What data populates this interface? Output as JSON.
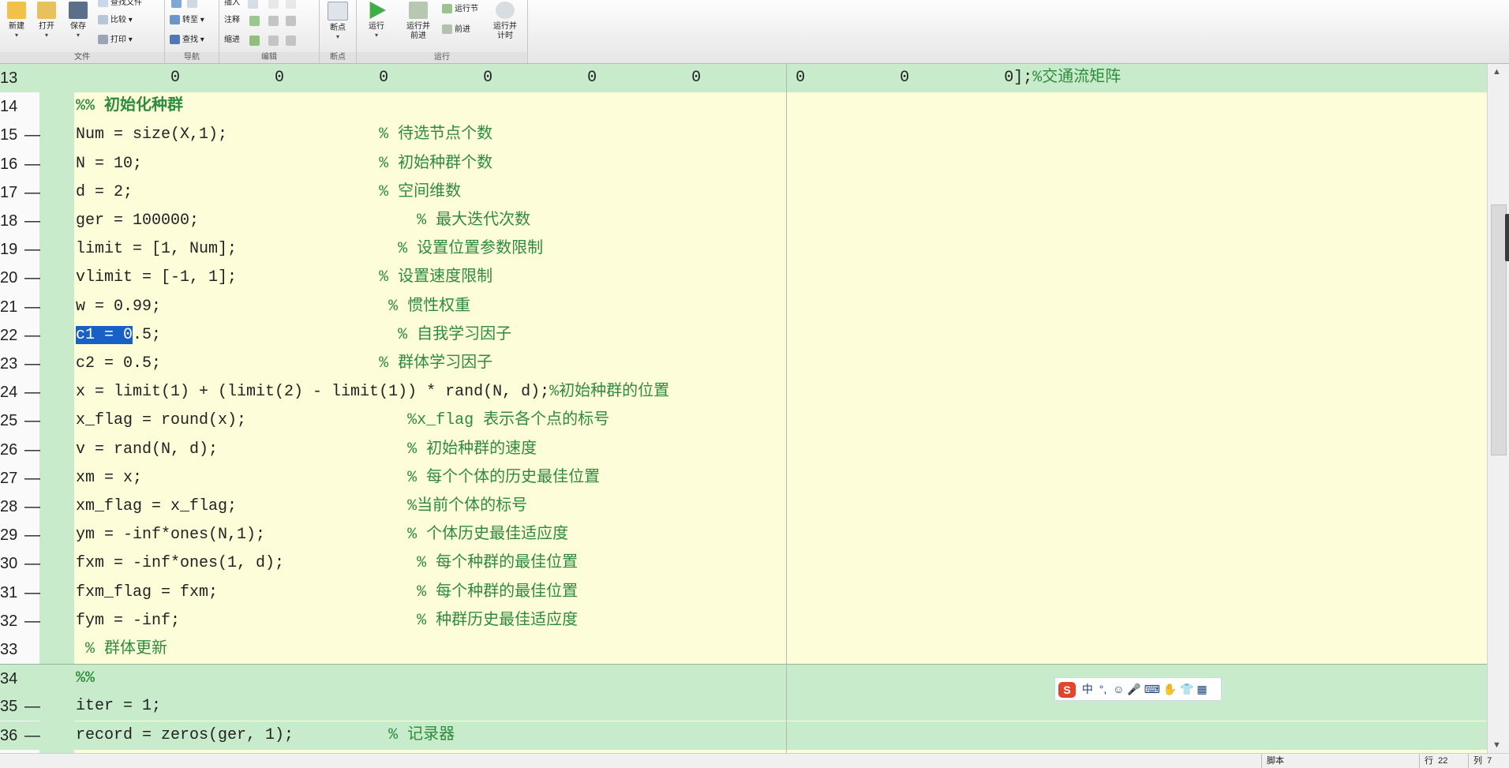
{
  "toolstrip": {
    "groups": {
      "file": "文件",
      "navigate": "导航",
      "edit": "编辑",
      "breakpoints": "断点",
      "run": "运行"
    },
    "buttons": {
      "new": "新建",
      "open": "打开",
      "save": "保存",
      "find_files": "查找文件",
      "compare": "比较",
      "print": "打印",
      "goto": "转至",
      "find": "查找",
      "insert": "插入",
      "comment": "注释",
      "indent": "缩进",
      "breakpoints": "断点",
      "run": "运行",
      "run_advance_1": "运行并",
      "run_advance_2": "前进",
      "run_section": "运行节",
      "advance": "前进",
      "run_time_1": "运行并",
      "run_time_2": "计时"
    },
    "icons": [
      "new-icon",
      "open-icon",
      "save-icon",
      "compare-icon",
      "print-icon",
      "back-icon",
      "goto-icon",
      "find-icon",
      "insert-icon",
      "fx-icon",
      "comment-icon",
      "indent-icon",
      "breakpoint-icon",
      "run-icon",
      "run-advance-icon",
      "run-section-icon",
      "advance-icon",
      "run-time-icon"
    ]
  },
  "editor": {
    "selected_text": "c1 = 0",
    "lines": [
      {
        "num": "13",
        "dash": false,
        "cell": true,
        "code": "          0          0          0          0          0          0          0          0          0];",
        "comment": "%交通流矩阵"
      },
      {
        "num": "14",
        "dash": false,
        "cell": false,
        "header": "%% 初始化种群"
      },
      {
        "num": "15",
        "dash": true,
        "cell": false,
        "code": "Num = size(X,1);                ",
        "comment": "% 待选节点个数"
      },
      {
        "num": "16",
        "dash": true,
        "cell": false,
        "code": "N = 10;                         ",
        "comment": "% 初始种群个数"
      },
      {
        "num": "17",
        "dash": true,
        "cell": false,
        "code": "d = 2;                          ",
        "comment": "% 空间维数"
      },
      {
        "num": "18",
        "dash": true,
        "cell": false,
        "code": "ger = 100000;                       ",
        "comment": "% 最大迭代次数"
      },
      {
        "num": "19",
        "dash": true,
        "cell": false,
        "code": "limit = [1, Num];                 ",
        "comment": "% 设置位置参数限制"
      },
      {
        "num": "20",
        "dash": true,
        "cell": false,
        "code": "vlimit = [-1, 1];               ",
        "comment": "% 设置速度限制"
      },
      {
        "num": "21",
        "dash": true,
        "cell": false,
        "code": "w = 0.99;                        ",
        "comment": "% 惯性权重"
      },
      {
        "num": "22",
        "dash": true,
        "cell": false,
        "selected": true,
        "code_after": ".5;                         ",
        "comment": "% 自我学习因子"
      },
      {
        "num": "23",
        "dash": true,
        "cell": false,
        "code": "c2 = 0.5;                       ",
        "comment": "% 群体学习因子"
      },
      {
        "num": "24",
        "dash": true,
        "cell": false,
        "code": "x = limit(1) + (limit(2) - limit(1)) * rand(N, d);",
        "comment": "%初始种群的位置"
      },
      {
        "num": "25",
        "dash": true,
        "cell": false,
        "code": "x_flag = round(x);                 ",
        "comment": "%x_flag 表示各个点的标号"
      },
      {
        "num": "26",
        "dash": true,
        "cell": false,
        "code": "v = rand(N, d);                    ",
        "comment": "% 初始种群的速度"
      },
      {
        "num": "27",
        "dash": true,
        "cell": false,
        "code": "xm = x;                            ",
        "comment": "% 每个个体的历史最佳位置"
      },
      {
        "num": "28",
        "dash": true,
        "cell": false,
        "code": "xm_flag = x_flag;                  ",
        "comment": "%当前个体的标号"
      },
      {
        "num": "29",
        "dash": true,
        "cell": false,
        "code": "ym = -inf*ones(N,1);               ",
        "comment": "% 个体历史最佳适应度"
      },
      {
        "num": "30",
        "dash": true,
        "cell": false,
        "code": "fxm = -inf*ones(1, d);              ",
        "comment": "% 每个种群的最佳位置"
      },
      {
        "num": "31",
        "dash": true,
        "cell": false,
        "code": "fxm_flag = fxm;                     ",
        "comment": "% 每个种群的最佳位置"
      },
      {
        "num": "32",
        "dash": true,
        "cell": false,
        "code": "fym = -inf;                         ",
        "comment": "% 种群历史最佳适应度"
      },
      {
        "num": "33",
        "dash": false,
        "cell": false,
        "code": " ",
        "comment": "% 群体更新"
      },
      {
        "num": "34",
        "dash": false,
        "cell": true,
        "header": "%%"
      },
      {
        "num": "35",
        "dash": true,
        "cell": true,
        "code": "iter = 1;"
      },
      {
        "num": "36",
        "dash": true,
        "cell": true,
        "code": "record = zeros(ger, 1);          ",
        "comment": "% 记录器"
      }
    ]
  },
  "ime": {
    "logo": "S",
    "mode": "中",
    "punct": "°,",
    "symbols": "☺ 🎤 ⌨ ✋ 👕 ▦"
  },
  "statusbar": {
    "mode": "脚本",
    "row_label": "行",
    "row": "22",
    "col_label": "列",
    "col": "7"
  },
  "colors": {
    "cell_bg": "#c8eccb",
    "editor_bg": "#fdfdda",
    "comment": "#2e8b3e",
    "selection": "#1860c8"
  }
}
